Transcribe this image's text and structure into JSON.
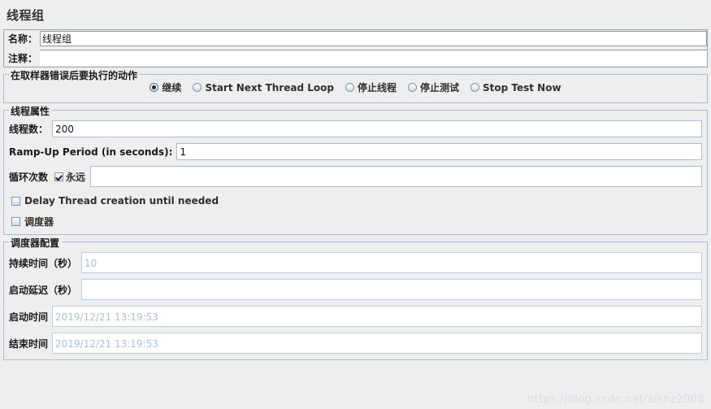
{
  "panel": {
    "title": "线程组"
  },
  "identity": {
    "name_label": "名称：",
    "name_value": "线程组",
    "comment_label": "注释：",
    "comment_value": ""
  },
  "on_error": {
    "group_title": "在取样器错误后要执行的动作",
    "options": [
      {
        "label": "继续",
        "selected": true
      },
      {
        "label": "Start Next Thread Loop",
        "selected": false
      },
      {
        "label": "停止线程",
        "selected": false
      },
      {
        "label": "停止测试",
        "selected": false
      },
      {
        "label": "Stop Test Now",
        "selected": false
      }
    ]
  },
  "thread_properties": {
    "group_title": "线程属性",
    "num_threads_label": "线程数：",
    "num_threads_value": "200",
    "ramp_up_label": "Ramp-Up Period (in seconds):",
    "ramp_up_value": "1",
    "loop_count_label": "循环次数",
    "forever_label": "永远",
    "forever_checked": true,
    "loop_count_value": "",
    "delay_thread_label": "Delay Thread creation until needed",
    "delay_thread_checked": false,
    "scheduler_label": "调度器",
    "scheduler_checked": false
  },
  "scheduler_config": {
    "group_title": "调度器配置",
    "duration_label": "持续时间（秒）",
    "duration_value": "10",
    "startup_delay_label": "启动延迟（秒）",
    "startup_delay_value": "",
    "start_time_label": "启动时间",
    "start_time_value": "2019/12/21 13:19:53",
    "end_time_label": "结束时间",
    "end_time_value": "2019/12/21 13:19:53"
  },
  "watermark": {
    "text": "https://blog.csdn.net/alshz2008"
  }
}
